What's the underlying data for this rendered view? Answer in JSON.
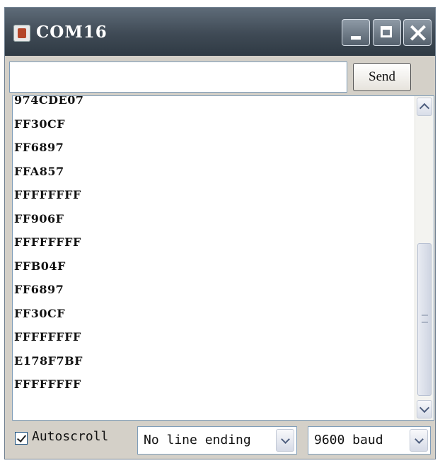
{
  "window": {
    "title": "COM16"
  },
  "send_bar": {
    "input_value": "",
    "send_label": "Send"
  },
  "output": {
    "partial_top_line": "974CDE07",
    "lines": [
      "FF30CF",
      "FF6897",
      "FFA857",
      "FFFFFFFF",
      "FF906F",
      "FFFFFFFF",
      "FFB04F",
      "FF6897",
      "FF30CF",
      "FFFFFFFF",
      "E178F7BF",
      "FFFFFFFF"
    ]
  },
  "footer": {
    "autoscroll_label": "Autoscroll",
    "autoscroll_checked": true,
    "line_ending": "No line ending",
    "baud": "9600 baud"
  },
  "icons": {
    "app": "java-cup-icon",
    "minimize": "minimize-icon",
    "maximize": "maximize-icon",
    "close": "close-icon",
    "checkbox": "checkbox-checked-icon",
    "dropdown": "chevron-down-icon",
    "scroll_up": "chevron-up-icon",
    "scroll_down": "chevron-down-icon"
  },
  "colors": {
    "titlebar": "#3f4a55",
    "window_bg": "#d4d0c8",
    "output_bg": "#ffffff",
    "field_border": "#7f9db9"
  }
}
